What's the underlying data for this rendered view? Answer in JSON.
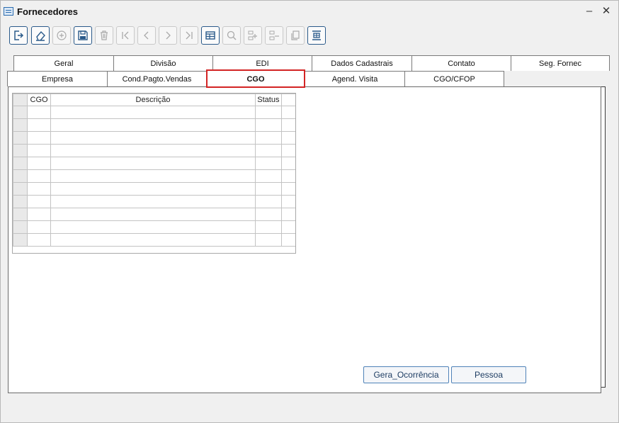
{
  "window": {
    "title": "Fornecedores",
    "minimize_glyph": "–",
    "close_glyph": "✕"
  },
  "toolbar": {
    "buttons": [
      {
        "name": "exit-icon",
        "enabled": true
      },
      {
        "name": "eraser-icon",
        "enabled": true
      },
      {
        "name": "add-icon",
        "enabled": false
      },
      {
        "name": "save-icon",
        "enabled": true
      },
      {
        "name": "delete-icon",
        "enabled": false
      },
      {
        "name": "first-record-icon",
        "enabled": false
      },
      {
        "name": "previous-record-icon",
        "enabled": false
      },
      {
        "name": "next-record-icon",
        "enabled": false
      },
      {
        "name": "last-record-icon",
        "enabled": false
      },
      {
        "name": "grid-view-icon",
        "enabled": true
      },
      {
        "name": "search-icon",
        "enabled": false
      },
      {
        "name": "insert-line-icon",
        "enabled": false
      },
      {
        "name": "remove-line-icon",
        "enabled": false
      },
      {
        "name": "copy-icon",
        "enabled": false
      },
      {
        "name": "column-insert-icon",
        "enabled": true
      }
    ]
  },
  "tabs_top": [
    "Geral",
    "Divisão",
    "EDI",
    "Dados Cadastrais",
    "Contato",
    "Seg. Fornec"
  ],
  "tabs_bottom": [
    "Empresa",
    "Cond.Pagto.Vendas",
    "CGO",
    "Agend. Visita",
    "CGO/CFOP"
  ],
  "selected_tab": "CGO",
  "grid": {
    "columns": [
      "CGO",
      "Descrição",
      "Status"
    ],
    "rows": [
      [
        "",
        "",
        ""
      ],
      [
        "",
        "",
        ""
      ],
      [
        "",
        "",
        ""
      ],
      [
        "",
        "",
        ""
      ],
      [
        "",
        "",
        ""
      ],
      [
        "",
        "",
        ""
      ],
      [
        "",
        "",
        ""
      ],
      [
        "",
        "",
        ""
      ],
      [
        "",
        "",
        ""
      ],
      [
        "",
        "",
        ""
      ],
      [
        "",
        "",
        ""
      ]
    ]
  },
  "buttons": {
    "gera_ocorrencia": "Gera_Ocorrência",
    "pessoa": "Pessoa"
  },
  "colors": {
    "selected_tab_border": "#d32424",
    "button_border": "#4f82b8",
    "active_icon": "#2a5a8a"
  }
}
